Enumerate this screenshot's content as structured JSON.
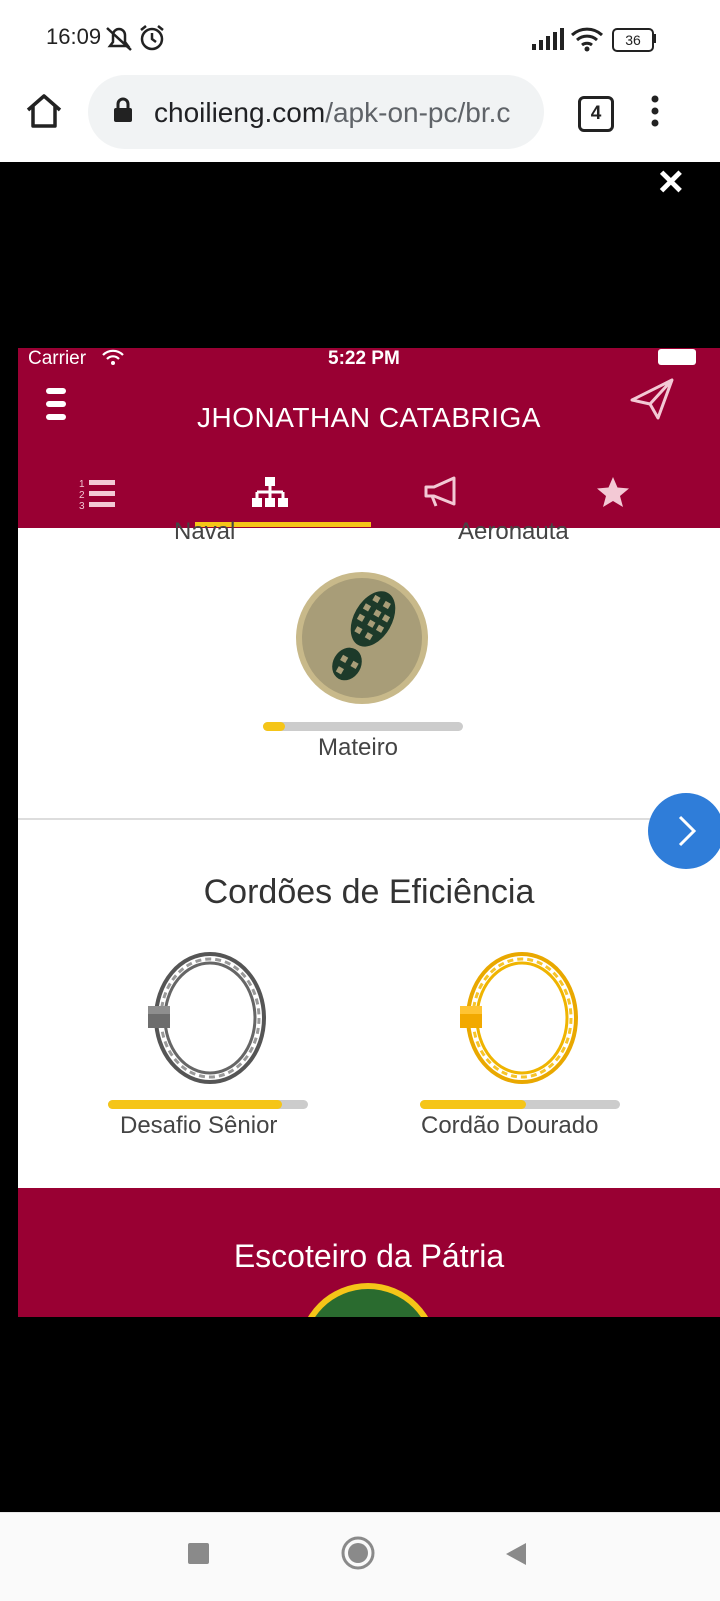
{
  "status_bar": {
    "time": "16:09",
    "battery": "36"
  },
  "browser": {
    "url_domain": "choilieng.com",
    "url_path": "/apk-on-pc/br.c",
    "tab_count": "4"
  },
  "viewer": {
    "close_label": "×"
  },
  "app": {
    "ios_status": {
      "carrier": "Carrier",
      "time": "5:22 PM"
    },
    "title": "JHONATHAN CATABRIGA",
    "tabs": [
      "list-numbered-icon",
      "hierarchy-icon",
      "megaphone-icon",
      "star-icon"
    ],
    "top_labels": {
      "left": "Naval",
      "right": "Aeronauta"
    },
    "badge": {
      "label": "Mateiro",
      "progress": 0.11
    },
    "section_title": "Cordões de Eficiência",
    "cords": [
      {
        "label": "Desafio Sênior",
        "progress": 0.87,
        "color": "#777777"
      },
      {
        "label": "Cordão Dourado",
        "progress": 0.53,
        "color": "#f2b705"
      }
    ],
    "bottom_section_title": "Escoteiro da Pátria",
    "colors": {
      "header": "#990033",
      "accent": "#f5c518",
      "next_button": "#2f7dd9"
    }
  },
  "nav_bar": {
    "items": [
      "recents-square-icon",
      "home-circle-icon",
      "back-triangle-icon"
    ]
  }
}
